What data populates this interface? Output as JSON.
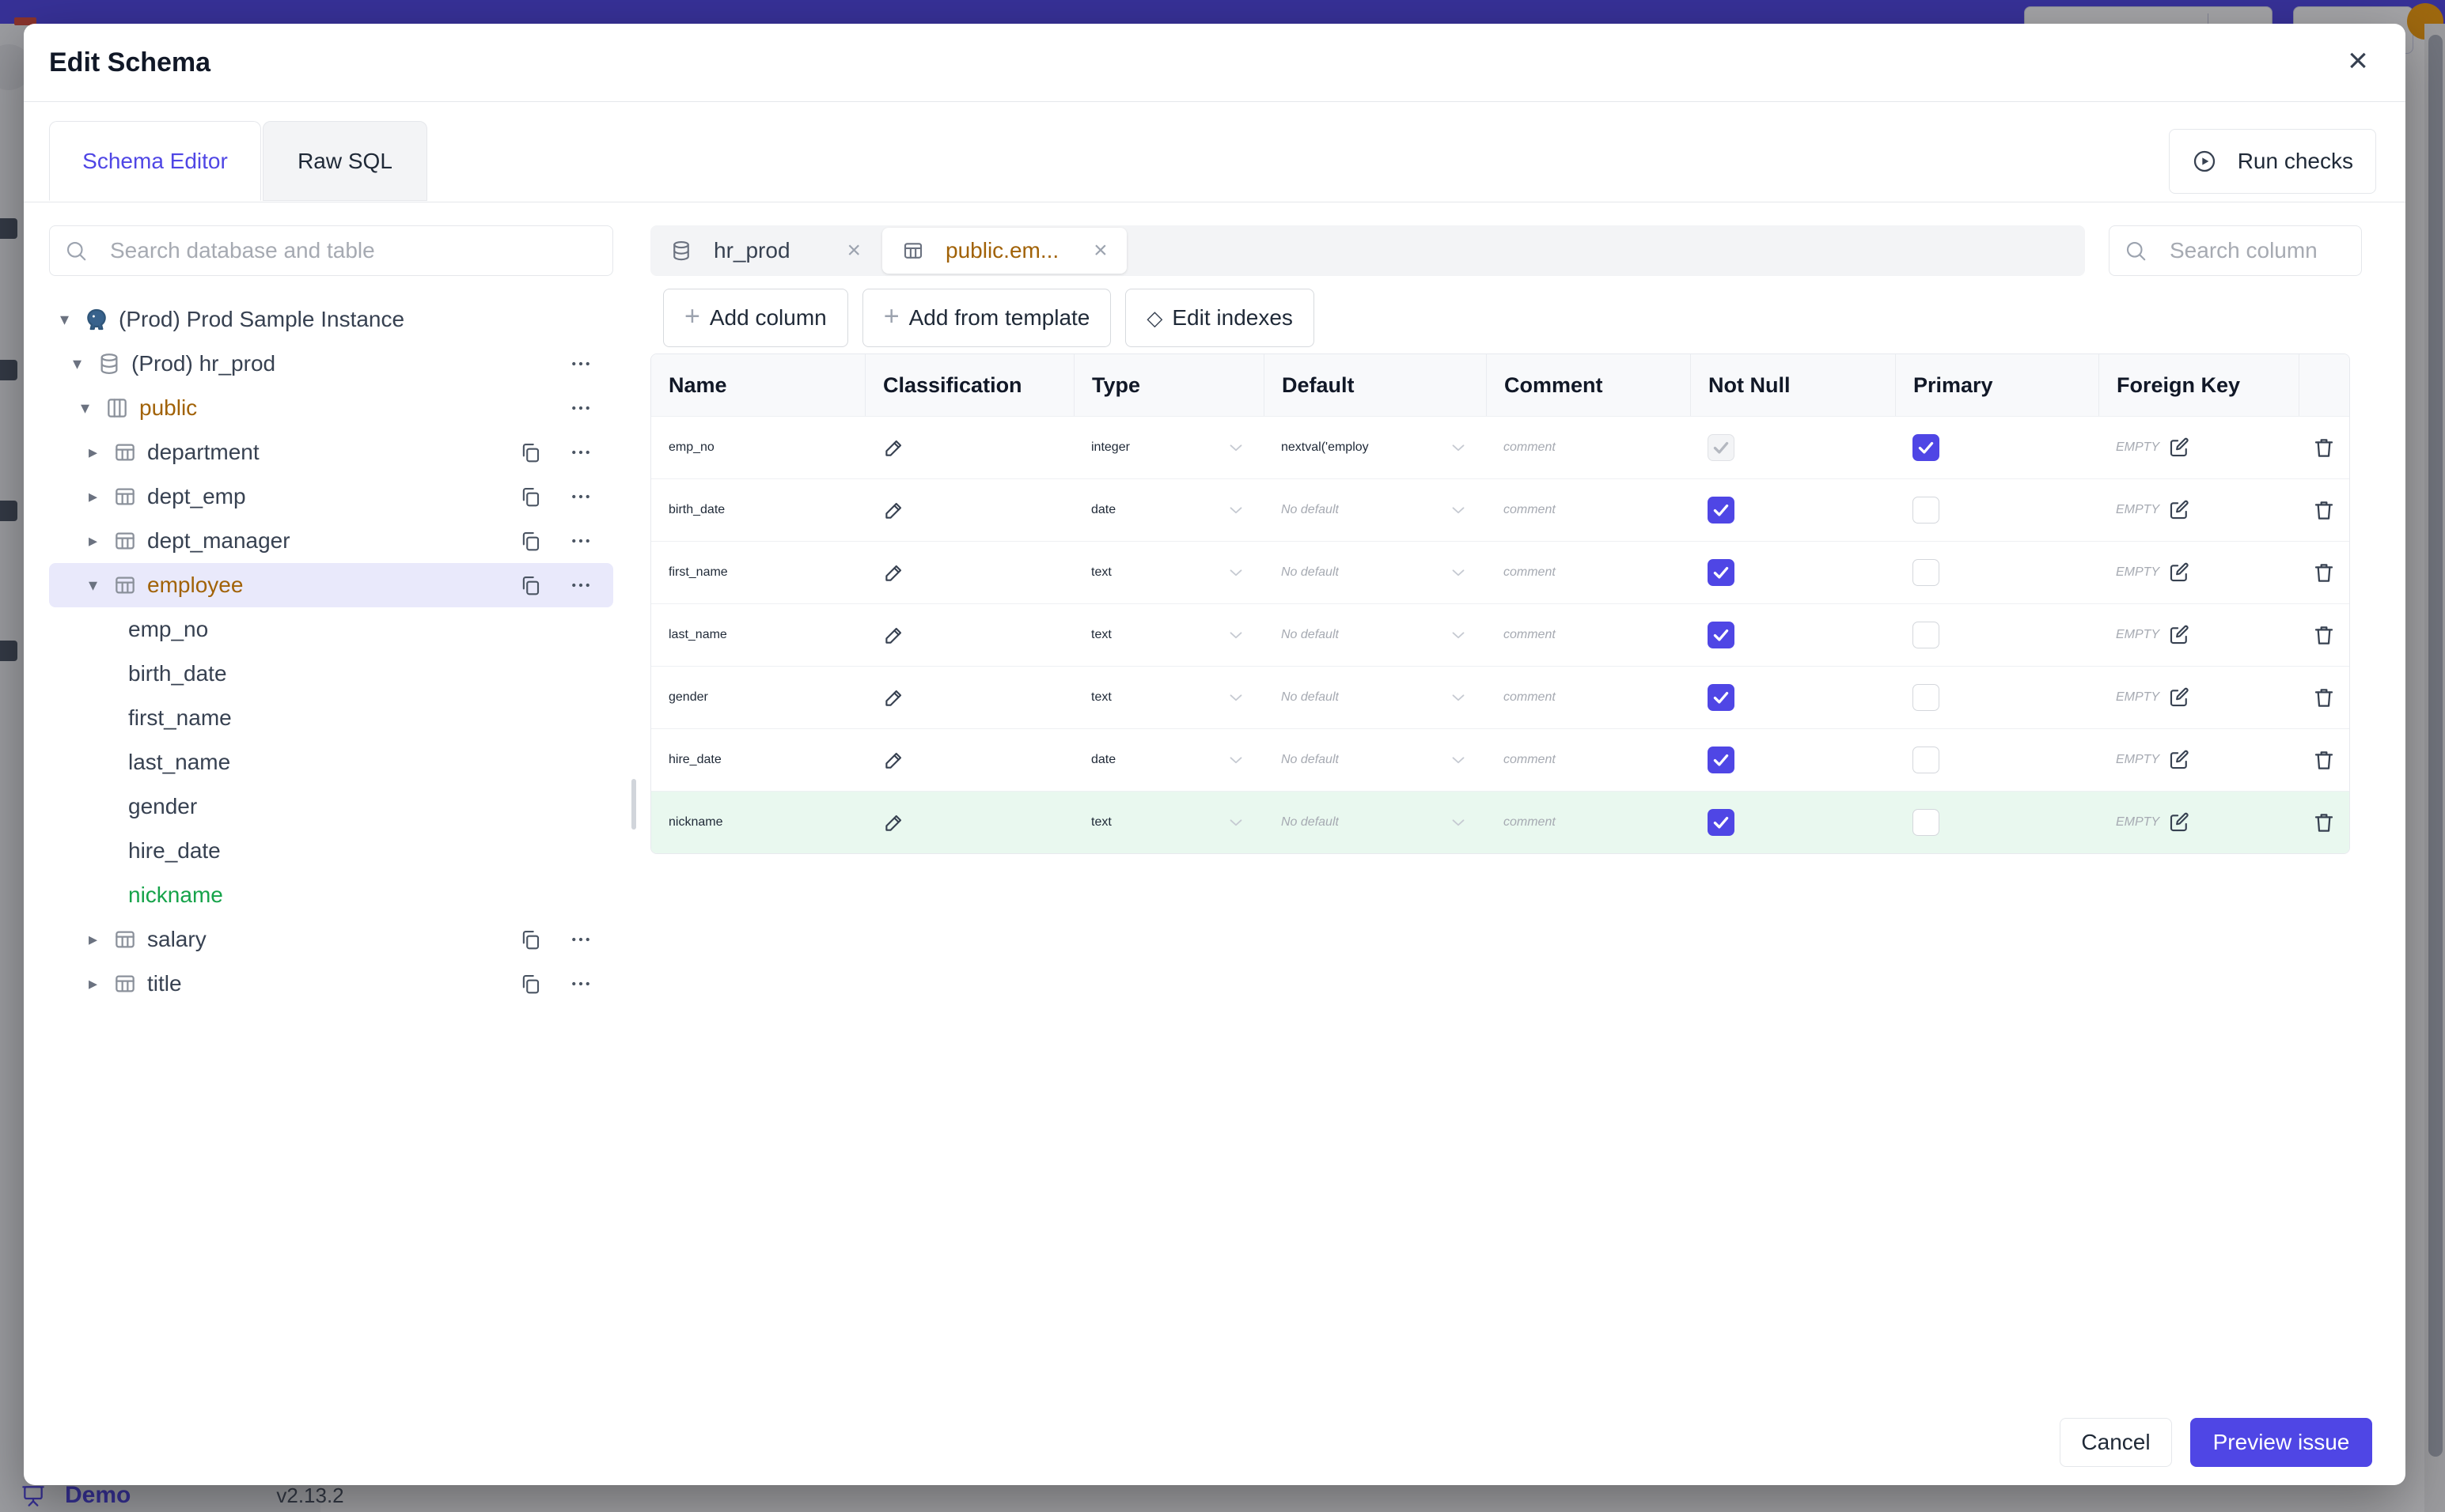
{
  "background": {
    "demo_label": "Demo",
    "version": "v2.13.2",
    "topbar_color": "#4f46e5"
  },
  "modal": {
    "title": "Edit Schema",
    "close_glyph": "×",
    "tabs": [
      {
        "label": "Schema Editor",
        "active": true
      },
      {
        "label": "Raw SQL",
        "active": false
      }
    ],
    "run_checks": {
      "label": "Run checks",
      "icon": "play-circle"
    },
    "sidebar": {
      "search_placeholder": "Search database and table",
      "tree": [
        {
          "label": "(Prod) Prod Sample Instance",
          "level": 0,
          "kind": "node",
          "icon": "postgresql",
          "caret": "down",
          "actions": []
        },
        {
          "label": "(Prod) hr_prod",
          "level": 1,
          "kind": "node",
          "icon": "database",
          "caret": "down",
          "actions": [
            "more"
          ]
        },
        {
          "label": "public",
          "level": 2,
          "kind": "node",
          "icon": "schema",
          "caret": "down",
          "color": "#a16207",
          "actions": [
            "more"
          ]
        },
        {
          "label": "department",
          "level": 3,
          "kind": "node",
          "icon": "table",
          "caret": "right",
          "actions": [
            "copy",
            "more"
          ]
        },
        {
          "label": "dept_emp",
          "level": 3,
          "kind": "node",
          "icon": "table",
          "caret": "right",
          "actions": [
            "copy",
            "more"
          ]
        },
        {
          "label": "dept_manager",
          "level": 3,
          "kind": "node",
          "icon": "table",
          "caret": "right",
          "actions": [
            "copy",
            "more"
          ]
        },
        {
          "label": "employee",
          "level": 3,
          "kind": "node",
          "icon": "table",
          "caret": "down",
          "color": "#a16207",
          "selected": true,
          "actions": [
            "copy",
            "more"
          ]
        },
        {
          "label": "emp_no",
          "level": 4,
          "kind": "column"
        },
        {
          "label": "birth_date",
          "level": 4,
          "kind": "column"
        },
        {
          "label": "first_name",
          "level": 4,
          "kind": "column"
        },
        {
          "label": "last_name",
          "level": 4,
          "kind": "column"
        },
        {
          "label": "gender",
          "level": 4,
          "kind": "column"
        },
        {
          "label": "hire_date",
          "level": 4,
          "kind": "column"
        },
        {
          "label": "nickname",
          "level": 4,
          "kind": "column",
          "color": "#16a34a"
        },
        {
          "label": "salary",
          "level": 3,
          "kind": "node",
          "icon": "table",
          "caret": "right",
          "actions": [
            "copy",
            "more"
          ]
        },
        {
          "label": "title",
          "level": 3,
          "kind": "node",
          "icon": "table",
          "caret": "right",
          "actions": [
            "copy",
            "more"
          ]
        }
      ]
    },
    "editor": {
      "tabs": [
        {
          "label": "hr_prod",
          "icon": "database",
          "active": false
        },
        {
          "label": "public.em...",
          "icon": "table",
          "active": true
        }
      ],
      "search_placeholder": "Search column",
      "toolbar": [
        {
          "label": "Add column",
          "icon": "plus"
        },
        {
          "label": "Add from template",
          "icon": "plus"
        },
        {
          "label": "Edit indexes",
          "icon": "diamond"
        }
      ],
      "table": {
        "headers": [
          "Name",
          "Classification",
          "Type",
          "Default",
          "Comment",
          "Not Null",
          "Primary",
          "Foreign Key",
          ""
        ],
        "comment_placeholder": "comment",
        "foreign_key_empty": "EMPTY",
        "rows": [
          {
            "name": "emp_no",
            "type": "integer",
            "default": "nextval('employ",
            "default_is_placeholder": false,
            "not_null_checked": true,
            "not_null_disabled": true,
            "primary_checked": true,
            "highlight": false
          },
          {
            "name": "birth_date",
            "type": "date",
            "default": "No default",
            "default_is_placeholder": true,
            "not_null_checked": true,
            "not_null_disabled": false,
            "primary_checked": false,
            "highlight": false
          },
          {
            "name": "first_name",
            "type": "text",
            "default": "No default",
            "default_is_placeholder": true,
            "not_null_checked": true,
            "not_null_disabled": false,
            "primary_checked": false,
            "highlight": false
          },
          {
            "name": "last_name",
            "type": "text",
            "default": "No default",
            "default_is_placeholder": true,
            "not_null_checked": true,
            "not_null_disabled": false,
            "primary_checked": false,
            "highlight": false
          },
          {
            "name": "gender",
            "type": "text",
            "default": "No default",
            "default_is_placeholder": true,
            "not_null_checked": true,
            "not_null_disabled": false,
            "primary_checked": false,
            "highlight": false
          },
          {
            "name": "hire_date",
            "type": "date",
            "default": "No default",
            "default_is_placeholder": true,
            "not_null_checked": true,
            "not_null_disabled": false,
            "primary_checked": false,
            "highlight": false
          },
          {
            "name": "nickname",
            "type": "text",
            "default": "No default",
            "default_is_placeholder": true,
            "not_null_checked": true,
            "not_null_disabled": false,
            "primary_checked": false,
            "highlight": true
          }
        ]
      }
    },
    "footer": {
      "cancel_label": "Cancel",
      "submit_label": "Preview issue"
    }
  },
  "colors": {
    "accent": "#4f46e5",
    "table_name_amber": "#a16207",
    "new_item_green": "#16a34a",
    "highlight_row_green": "#e9f8ef",
    "selected_tree_bg": "#e9e9fb"
  }
}
